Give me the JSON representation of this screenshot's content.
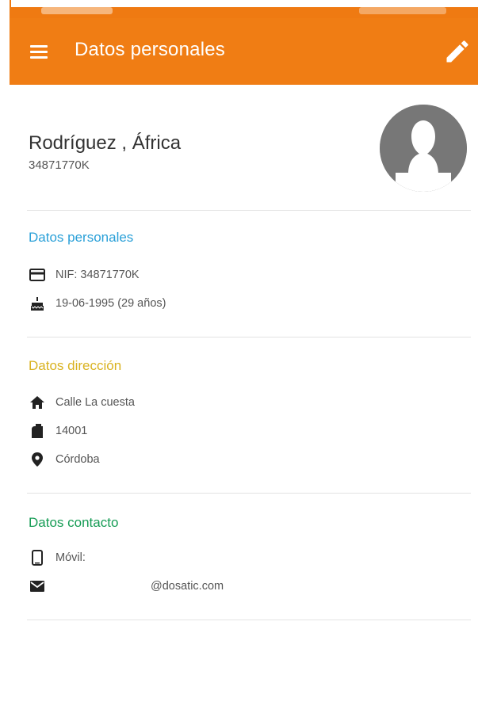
{
  "appbar": {
    "title": "Datos personales",
    "menu_icon": "menu-icon",
    "edit_icon": "pencil-icon",
    "background": "#f07d14"
  },
  "profile": {
    "name": "Rodríguez , África",
    "id_number": "34871770K",
    "avatar_icon": "person-silhouette-icon"
  },
  "sections": {
    "personal": {
      "title": "Datos personales",
      "color": "#2aa0d8",
      "nif": "NIF: 34871770K",
      "birthdate": "19-06-1995 (29 años)"
    },
    "address": {
      "title": "Datos dirección",
      "color": "#d9b21f",
      "street": "Calle La cuesta",
      "postal_code": "14001",
      "city": "Córdoba"
    },
    "contact": {
      "title": "Datos contacto",
      "color": "#169c55",
      "mobile": "Móvil:",
      "email": "@dosatic.com"
    }
  }
}
